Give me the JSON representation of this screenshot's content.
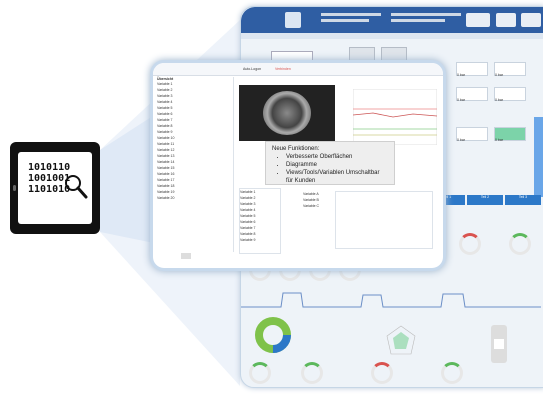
{
  "tablet": {
    "lines": [
      "1010110",
      "1001001",
      "1101010"
    ]
  },
  "front_window": {
    "toolbar": {
      "left_label": "Auto-Logon",
      "right_label": "Verbinden"
    },
    "tree_title": "Übersicht",
    "tree_items": [
      "Variable 1",
      "Variable 2",
      "Variable 3",
      "Variable 4",
      "Variable 5",
      "Variable 6",
      "Variable 7",
      "Variable 8",
      "Variable 9",
      "Variable 10",
      "Variable 11",
      "Variable 12",
      "Variable 13",
      "Variable 14",
      "Variable 15",
      "Variable 16",
      "Variable 17",
      "Variable 18",
      "Variable 19",
      "Variable 20"
    ],
    "callout": {
      "title": "Neue Funktionen:",
      "bullets": [
        "Verbesserte Oberflächen",
        "Diagramme",
        "Views/Tools/Variablen Umschaltbar für Kunden"
      ]
    },
    "list_left": [
      "Variable 1",
      "Variable 2",
      "Variable 3",
      "Variable 4",
      "Variable 5",
      "Variable 6",
      "Variable 7",
      "Variable 8",
      "Variable 9"
    ],
    "list_mid": [
      "Variable A",
      "Variable B",
      "Variable C"
    ]
  },
  "back_window": {
    "status_values": [
      "0 bar",
      "0 bar",
      "0 bar",
      "0 bar",
      "0 bar",
      "0 bar"
    ],
    "bottom_buttons": [
      "Teil 1",
      "Teil 2",
      "Teil 3"
    ]
  },
  "colors": {
    "accent": "#2f5ea3",
    "beam": "#c9d9f1",
    "donut_green": "#7fc24a",
    "donut_blue": "#2c78c8"
  }
}
